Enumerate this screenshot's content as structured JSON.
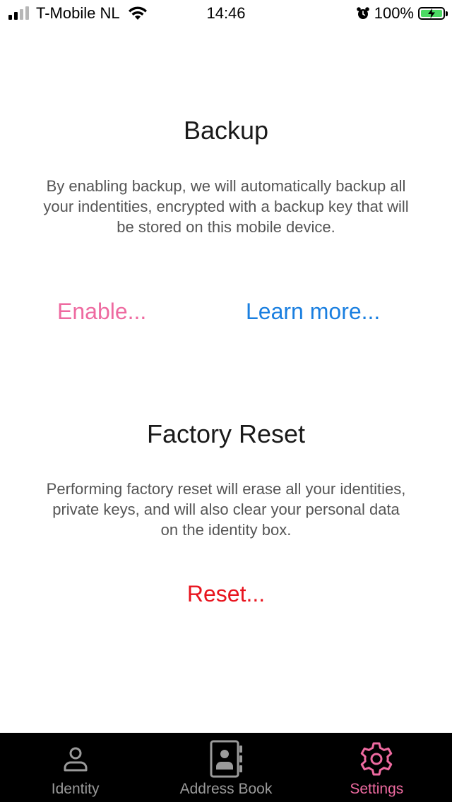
{
  "status_bar": {
    "carrier": "T-Mobile NL",
    "time": "14:46",
    "battery_percent": "100%",
    "signal_bars_filled": 2,
    "signal_bars_total": 4
  },
  "backup": {
    "title": "Backup",
    "description": "By enabling backup, we will automatically backup all your indentities, encrypted with a backup key that will be stored on this mobile device.",
    "enable_label": "Enable...",
    "learn_more_label": "Learn more..."
  },
  "factory_reset": {
    "title": "Factory Reset",
    "description": "Performing factory reset will erase all your identities, private keys, and will also clear your personal data on the identity box.",
    "reset_label": "Reset..."
  },
  "tabs": [
    {
      "label": "Identity",
      "icon": "person-icon",
      "active": false
    },
    {
      "label": "Address Book",
      "icon": "address-book-icon",
      "active": false
    },
    {
      "label": "Settings",
      "icon": "gear-icon",
      "active": true
    }
  ],
  "colors": {
    "accent_pink": "#ee6aa0",
    "link_blue": "#1a7fe0",
    "danger_red": "#e8141e",
    "tab_inactive": "#9a9a9a",
    "battery_green": "#4cd964"
  }
}
